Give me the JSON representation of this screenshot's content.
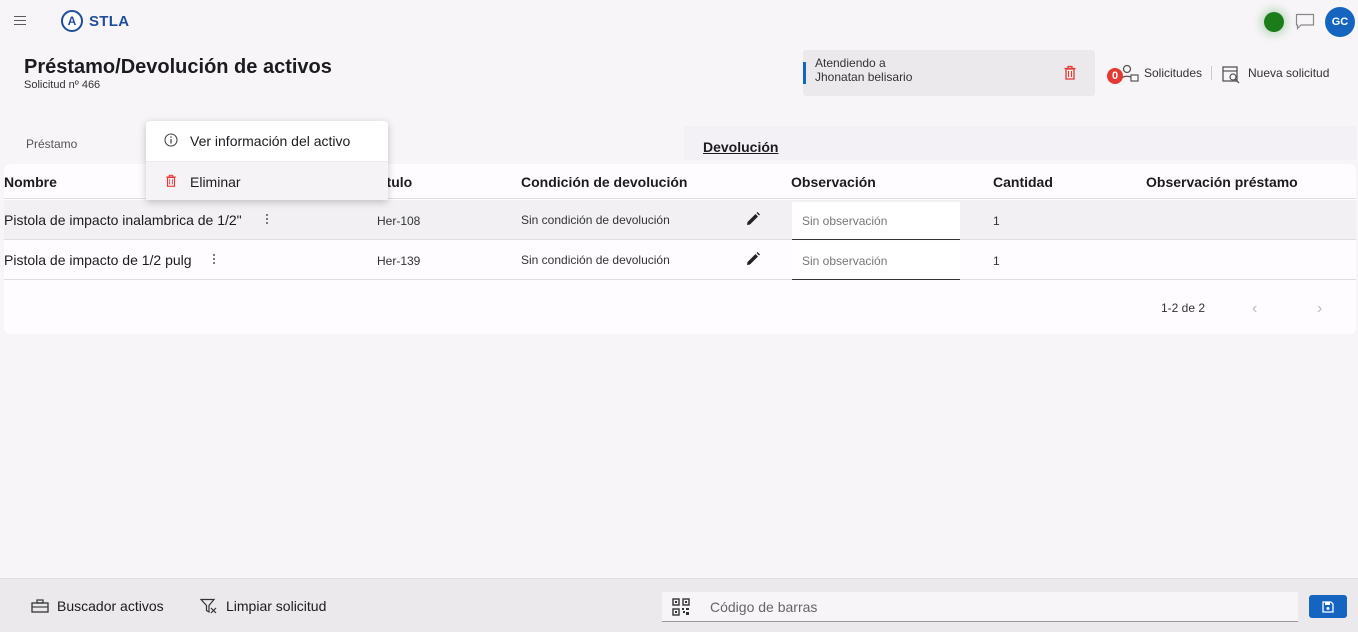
{
  "app": {
    "brand": "STLA",
    "logo_letter": "A",
    "avatar_initials": "GC"
  },
  "header": {
    "title": "Préstamo/Devolución de activos",
    "subtitle": "Solicitud nº 466",
    "attending_label": "Atendiendo a",
    "attending_name": "Jhonatan belisario",
    "requests_badge": "0",
    "requests_label": "Solicitudes",
    "new_request_label": "Nueva solicitud"
  },
  "tabs": {
    "loan": "Préstamo",
    "return": "Devolución"
  },
  "table": {
    "columns": {
      "name": "Nombre",
      "label": "ótulo",
      "condition": "Condición de devolución",
      "observation": "Observación",
      "quantity": "Cantidad",
      "loan_observation": "Observación préstamo"
    },
    "rows": [
      {
        "name": "Pistola de impacto inalambrica de 1/2\"",
        "label": "Her-108",
        "condition": "Sin condición de devolución",
        "observation_placeholder": "Sin observación",
        "quantity": "1",
        "loan_observation": ""
      },
      {
        "name": "Pistola de impacto de 1/2 pulg",
        "label": "Her-139",
        "condition": "Sin condición de devolución",
        "observation_placeholder": "Sin observación",
        "quantity": "1",
        "loan_observation": ""
      }
    ],
    "pagination": "1-2 de 2"
  },
  "context_menu": {
    "view_info": "Ver información del activo",
    "delete": "Eliminar"
  },
  "bottom": {
    "asset_search": "Buscador activos",
    "clear_request": "Limpiar solicitud",
    "barcode_placeholder": "Código de barras"
  },
  "colors": {
    "primary": "#1565c0",
    "status": "#1a7d1a",
    "danger": "#e53935"
  },
  "icons": [
    "menu-icon",
    "chat-icon",
    "trash-icon",
    "requests-icon",
    "new-request-icon",
    "kebab-icon",
    "edit-icon",
    "info-icon",
    "toolbox-icon",
    "filter-clear-icon",
    "qr-icon",
    "save-icon",
    "chevron-left-icon",
    "chevron-right-icon"
  ]
}
